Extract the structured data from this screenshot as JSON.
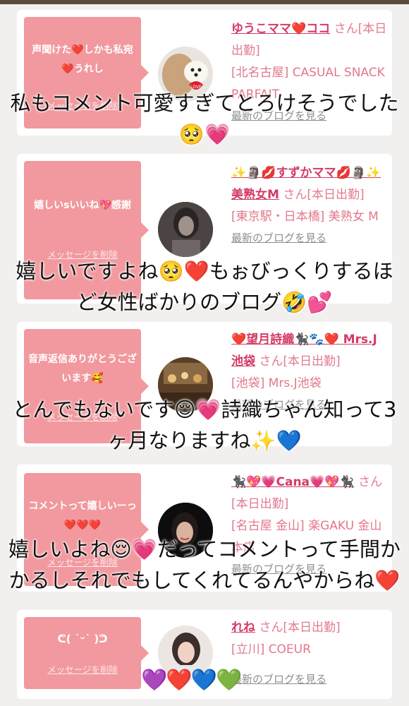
{
  "colors": {
    "bubble": "#f1999e",
    "name": "#d33b66",
    "shop": "#e3778a",
    "background": "#f2f0ee"
  },
  "cards": [
    {
      "bubble_text": "声聞けた❤️しかも私宛❤️うれし",
      "delete_label": "メッセージを削除",
      "name": "ゆうこママ❤️ココ",
      "san": "さん[本日出勤]",
      "shop": "[北名古屋] CASUAL SNACK PARFAIT",
      "blog": "最新のブログを見る",
      "avatar": "dog-photo"
    },
    {
      "bubble_text": "嬉しいsいいね💖感謝",
      "delete_label": "メッセージを削除",
      "name": "✨🗿💋すずかママ💋🗿✨美熟女M",
      "san": "さん[本日出勤]",
      "shop": "[東京駅・日本橋] 美熟女 M",
      "blog": "最新のブログを見る",
      "avatar": "woman-dark-photo"
    },
    {
      "bubble_text": "音声返信ありがとうございます🥰",
      "delete_label": "メッセージを削除",
      "name": "❤️望月詩織🐈‍⬛🐾❤️ Mrs.J池袋",
      "san": "さん[本日出勤]",
      "shop": "[池袋] Mrs.J池袋",
      "blog": "最新のブログを見る",
      "avatar": "bar-photo"
    },
    {
      "bubble_text": "コメントって嬉しいーっ❤️❤️❤️",
      "delete_label": "メッセージを削除",
      "name": "🐈‍⬛💖💗Cana💗💖🐈‍⬛",
      "san": "さん[本日出勤]",
      "shop": "[名古屋 金山] 楽GAKU 金山本店",
      "blog": "最新のブログを見る",
      "avatar": "woman-black-bg-photo"
    },
    {
      "bubble_text": "ᕦ( ˙ᵕ˙ )ᕤ",
      "delete_label": "メッセージを削除",
      "name": "れね",
      "san": "さん[本日出勤]",
      "shop": "[立川] COEUR",
      "blog": "最新のブログを見る",
      "avatar": "woman-light-photo"
    }
  ],
  "overlays": [
    "私もコメント可愛すぎてとろけそうでした🥺💗",
    "嬉しいですよね🥺❤️もぉびっくりするほど女性ばかりのブログ🤣💕",
    "とんでもないです😌💗詩織ちゃん知って3ヶ月なりますね✨💙",
    "嬉しいよね😌💗だってコメントって手間かかるしそれでもしてくれてるんやからね❤️",
    "💜❤️💙💚"
  ]
}
